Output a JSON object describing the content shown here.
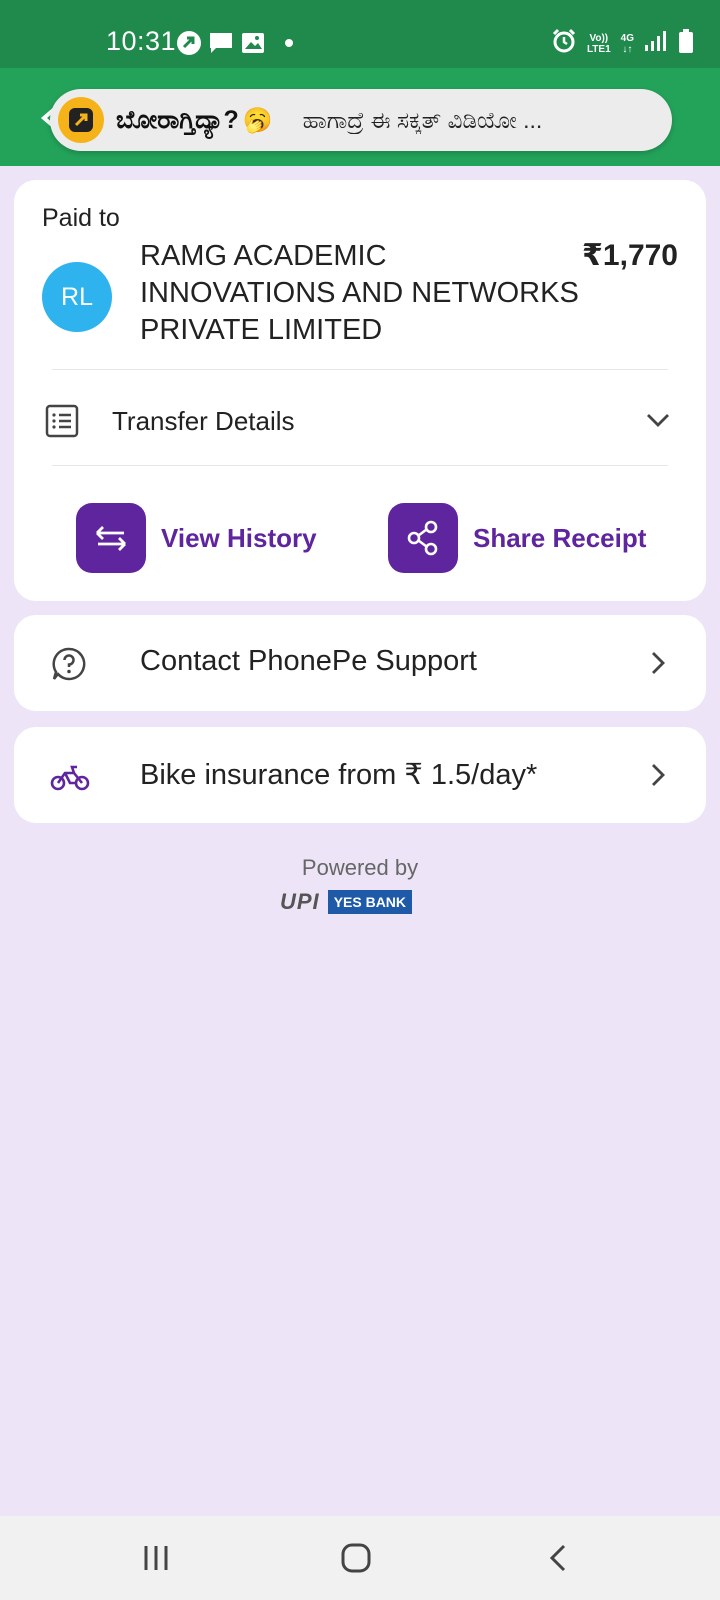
{
  "status_bar": {
    "time": "10:31",
    "network_top": "Vo))",
    "network_bottom": "LTE1",
    "network_type": "4G",
    "icons": [
      "phonepe-notification-icon",
      "message-icon",
      "gallery-icon",
      "dot-icon",
      "alarm-icon",
      "signal-icon",
      "battery-icon"
    ]
  },
  "header": {
    "notification_title": "ಬೋರಾಗ್ತಿದ್ಯಾ?",
    "notification_emoji": "🥱",
    "notification_text": "ಹಾಗಾದ್ರೆ ಈ ಸಕ್ಕತ್ ವಿಡಿಯೋ ..."
  },
  "payment": {
    "paid_to_label": "Paid to",
    "avatar_initials": "RL",
    "payee_name": "RAMG ACADEMIC INNOVATIONS AND NETWORKS PRIVATE LIMITED",
    "amount": "₹1,770",
    "transfer_details_label": "Transfer Details",
    "view_history_label": "View History",
    "share_receipt_label": "Share Receipt"
  },
  "support": {
    "label": "Contact PhonePe Support"
  },
  "insurance": {
    "label": "Bike insurance from ₹ 1.5/day*"
  },
  "footer": {
    "powered_by": "Powered by",
    "upi_logo_text": "UPI",
    "bank_logo_text": "YES BANK"
  },
  "colors": {
    "status_bar": "#1f8a4c",
    "header": "#23a35a",
    "brand_purple": "#5f259f",
    "background": "#ede5f7",
    "avatar": "#2eb3ef"
  }
}
